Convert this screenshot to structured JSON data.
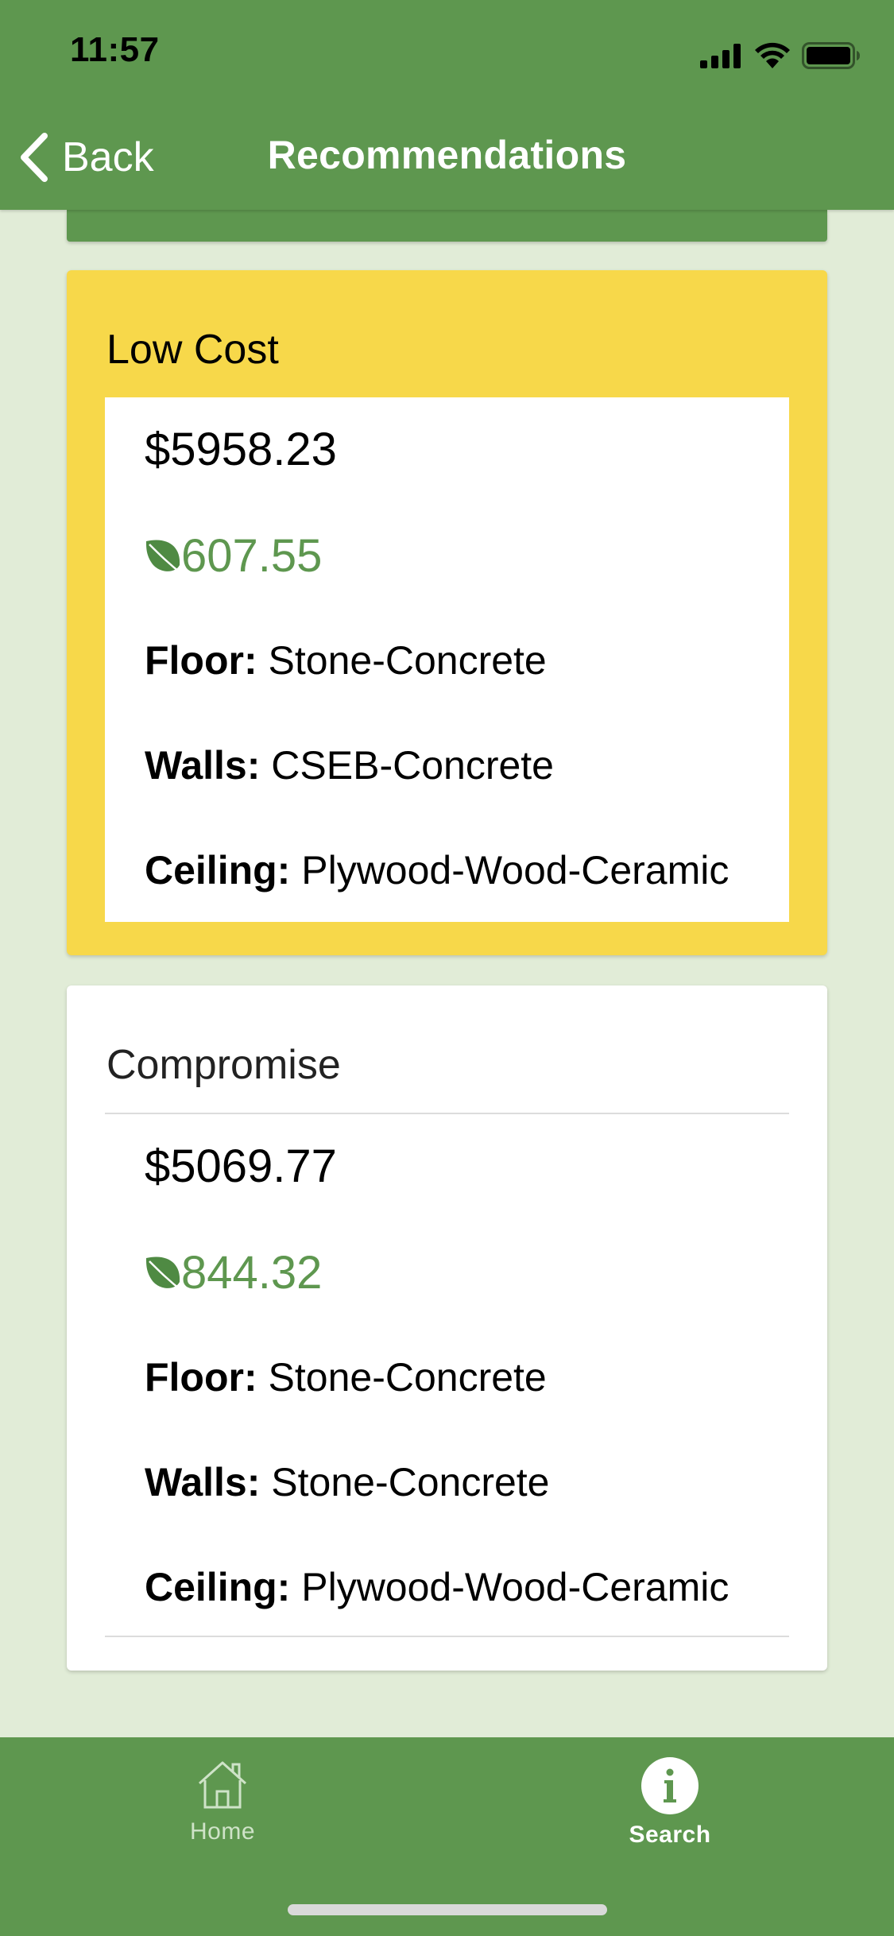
{
  "status_bar": {
    "time": "11:57"
  },
  "nav": {
    "back_label": "Back",
    "title": "Recommendations"
  },
  "cards": [
    {
      "title": "Low Cost",
      "price": "$5958.23",
      "eco_score": "607.55",
      "floor_label": "Floor:",
      "floor_value": "Stone-Concrete",
      "walls_label": "Walls:",
      "walls_value": "CSEB-Concrete",
      "ceiling_label": "Ceiling:",
      "ceiling_value": "Plywood-Wood-Ceramic",
      "highlighted": true
    },
    {
      "title": "Compromise",
      "price": "$5069.77",
      "eco_score": "844.32",
      "floor_label": "Floor:",
      "floor_value": "Stone-Concrete",
      "walls_label": "Walls:",
      "walls_value": "Stone-Concrete",
      "ceiling_label": "Ceiling:",
      "ceiling_value": "Plywood-Wood-Ceramic",
      "highlighted": false
    }
  ],
  "tabs": [
    {
      "label": "Home",
      "icon": "home-icon",
      "active": false
    },
    {
      "label": "Search",
      "icon": "info-icon",
      "active": true
    }
  ],
  "colors": {
    "brand_green": "#5e974f",
    "background": "#e1ecd7",
    "highlight_yellow": "#f7d84a"
  }
}
